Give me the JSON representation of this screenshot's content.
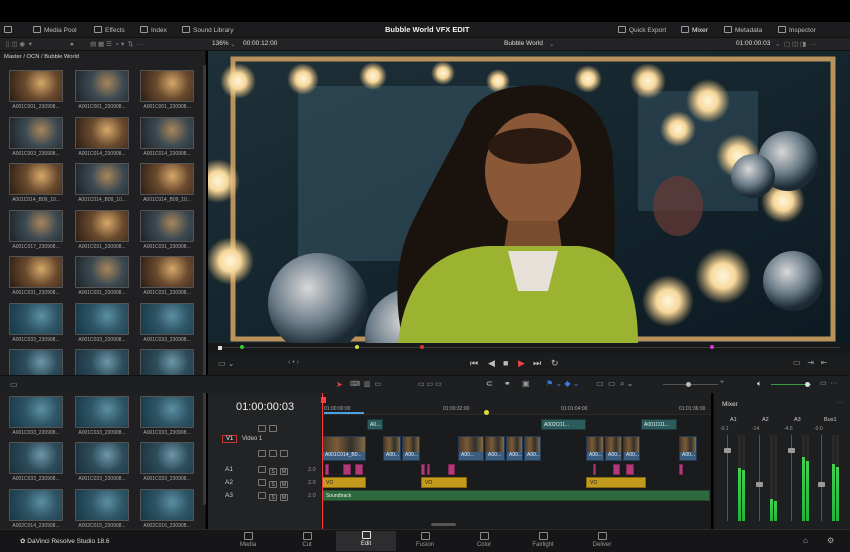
{
  "app": {
    "title": "Bubble World VFX EDIT",
    "brand": "DaVinci Resolve Studio 18.6"
  },
  "toolbar": {
    "left": [
      "Media Pool",
      "Effects",
      "Index",
      "Sound Library"
    ],
    "right": [
      "Quick Export",
      "Mixer",
      "Metadata",
      "Inspector"
    ]
  },
  "subbar": {
    "zoom": "136%",
    "source_timecode": "00:00:12:00",
    "timeline_name": "Bubble World",
    "record_timecode": "01:00:00:03"
  },
  "media_pool": {
    "path": "Master / OCN / Bubble World",
    "clips": [
      "A001C001_230908...",
      "A001C001_230908...",
      "A001C001_230908...",
      "A001C003_230908...",
      "A001C014_230908...",
      "A001C014_230908...",
      "A001C014_B09_10...",
      "A001C014_B09_10...",
      "A001C014_B09_10...",
      "A001C017_230908...",
      "A001C031_230908...",
      "A001C031_230908...",
      "A001C031_230908...",
      "A001C031_230908...",
      "A001C031_230908...",
      "A001C033_230908...",
      "A001C033_230908...",
      "A001C033_230908...",
      "A001C033_230908...",
      "A001C033_230908...",
      "A001C033_230908...",
      "A001C033_230908...",
      "A001C033_230908...",
      "A001C033_230908...",
      "A001C033_230908...",
      "A001C033_230908...",
      "A001C033_230908...",
      "A002C014_230908...",
      "A002C015_230908...",
      "A002C016_230908..."
    ]
  },
  "timeline": {
    "timecode": "01:00:00:03",
    "ruler": [
      "01:00:00:00",
      "01:00:32:00",
      "01:01:04:00",
      "01:01:36:00"
    ],
    "tracks": [
      {
        "id": "V1",
        "name": "Video 1"
      },
      {
        "id": "A1",
        "level": "2.0"
      },
      {
        "id": "A2",
        "level": "2.0"
      },
      {
        "id": "A3",
        "level": "2.0"
      }
    ],
    "title_clips": [
      "A0...",
      "A002C01...",
      "A001C01..."
    ],
    "video_clips": [
      "A001C014_B0...",
      "A00...",
      "A00...",
      "A00...",
      "A00...",
      "A00...",
      "A00...",
      "A00...",
      "A00...",
      "A00...",
      "A00..."
    ],
    "vo_clips": [
      "VO",
      "VO",
      "VO"
    ],
    "soundtrack": "Soundtrack"
  },
  "mixer": {
    "title": "Mixer",
    "channels": [
      "A1",
      "A2",
      "A3",
      "Bus1"
    ],
    "values": [
      "-0.1",
      "-14",
      "-4.6",
      "-0.0"
    ],
    "levels": [
      0.62,
      0.25,
      0.74,
      0.66
    ]
  },
  "pages": [
    "Media",
    "Cut",
    "Edit",
    "Fusion",
    "Color",
    "Fairlight",
    "Deliver"
  ],
  "active_page": "Edit",
  "colors": {
    "accent": "#e64545",
    "playhead": "#ff3b3b",
    "audio_clip": "#b3397a",
    "vo_clip": "#c29a1c",
    "soundtrack": "#2f6a3f",
    "video_clip": "#3b5d80"
  }
}
